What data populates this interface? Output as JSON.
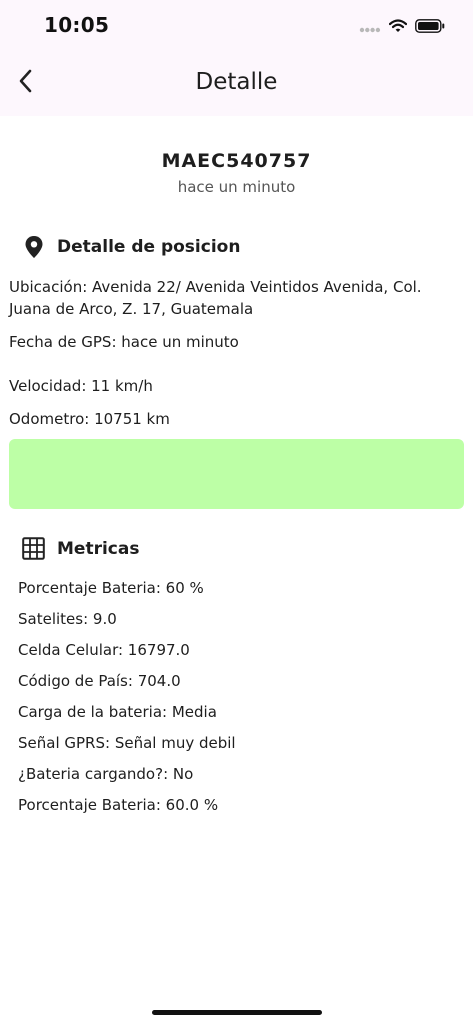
{
  "status_bar": {
    "time": "10:05"
  },
  "header": {
    "title": "Detalle"
  },
  "vehicle": {
    "plate": "MAEC540757",
    "updated": "hace un minuto"
  },
  "position": {
    "title": "Detalle de posicion",
    "location_line1": "Ubicación:   Avenida 22/ Avenida Veintidos Avenida, Col.",
    "location_line2": "Juana de Arco, Z. 17, Guatemala",
    "gps_date": "Fecha de GPS: hace un minuto",
    "speed": "Velocidad: 11 km/h",
    "odometer": "Odometro: 10751 km",
    "map_color": "#bdffa6"
  },
  "metrics": {
    "title": "Metricas",
    "items": [
      "Porcentaje Bateria: 60 %",
      "Satelites: 9.0",
      "Celda Celular: 16797.0",
      "Código de País: 704.0",
      "Carga de la bateria: Media",
      "Señal GPRS: Señal muy debil",
      "¿Bateria cargando?: No",
      "Porcentaje Bateria: 60.0 %"
    ]
  }
}
